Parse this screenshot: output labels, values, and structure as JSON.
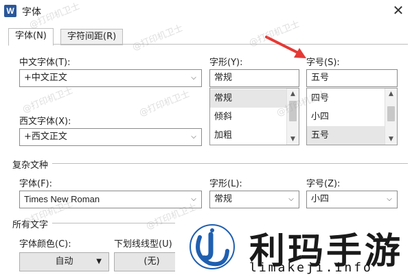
{
  "window": {
    "title": "字体",
    "app_icon": "W",
    "close_glyph": "✕"
  },
  "tabs": [
    {
      "label": "字体(N)",
      "active": true
    },
    {
      "label": "字符间距(R)",
      "active": false
    }
  ],
  "chinese_font": {
    "label": "中文字体(T):",
    "value": "+中文正文"
  },
  "western_font": {
    "label": "西文字体(X):",
    "value": "+西文正文"
  },
  "style": {
    "label": "字形(Y):",
    "value": "常规",
    "options": [
      "常规",
      "倾斜",
      "加粗"
    ],
    "selected_index": 0
  },
  "size": {
    "label": "字号(S):",
    "value": "五号",
    "options": [
      "四号",
      "小四",
      "五号"
    ],
    "selected_index": 2
  },
  "complex_script": {
    "group_title": "复杂文种",
    "font_label": "字体(F):",
    "font_value": "Times New Roman",
    "style_label": "字形(L):",
    "style_value": "常规",
    "size_label": "字号(Z):",
    "size_value": "小四"
  },
  "all_text": {
    "group_title": "所有文字",
    "color_label": "字体颜色(C):",
    "color_value": "自动",
    "underline_label": "下划线线型(U)",
    "underline_value": "(无)"
  },
  "watermark_text": "@打印机卫士",
  "logo": {
    "cn": "利玛手游",
    "en": "limakeji.info"
  },
  "colors": {
    "accent_arrow": "#e53935",
    "word_blue": "#2b579a",
    "logo_blue": "#1f5fb0"
  }
}
